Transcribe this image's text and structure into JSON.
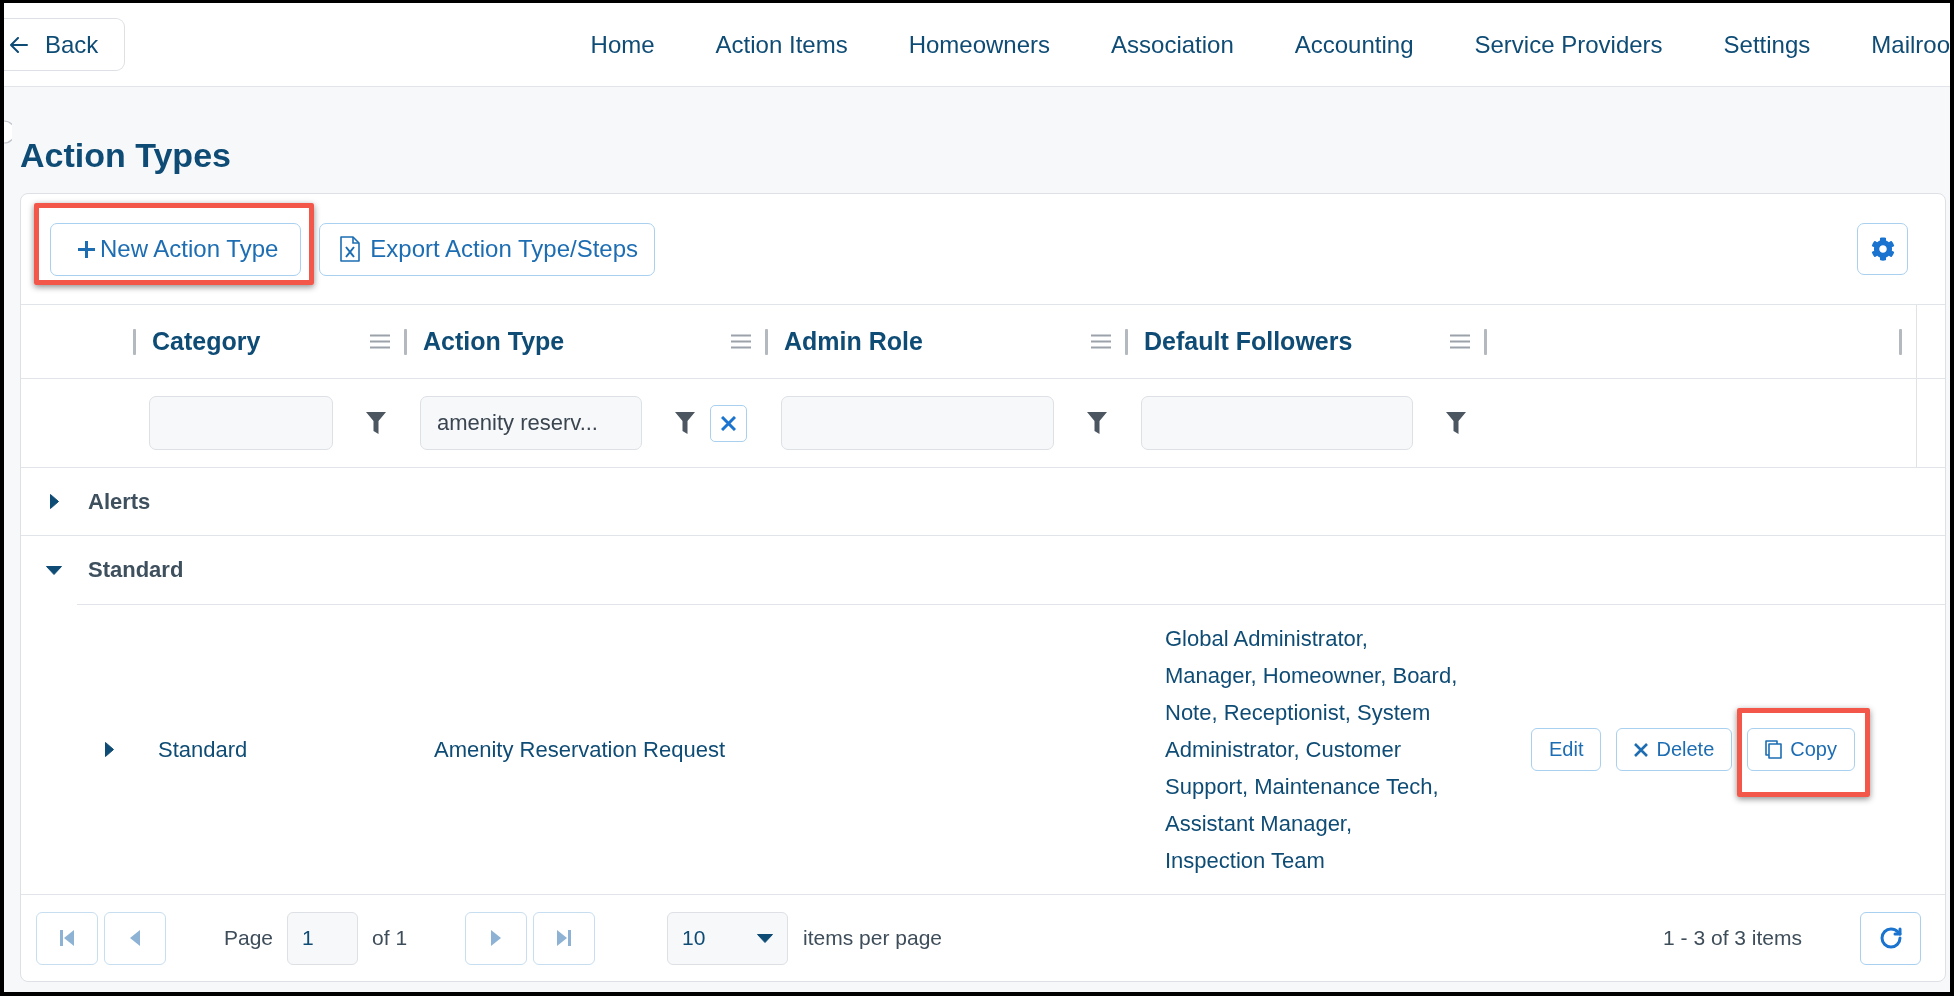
{
  "top_bar": {
    "back": "Back",
    "nav": [
      "Home",
      "Action Items",
      "Homeowners",
      "Association",
      "Accounting",
      "Service Providers",
      "Settings",
      "Mailroo"
    ]
  },
  "page_title": "Action Types",
  "toolbar": {
    "buttons": [
      {
        "kind": "add",
        "label": "New Action Type",
        "highlighted": true
      },
      {
        "kind": "export",
        "label": "Export Action Type/Steps",
        "highlighted": false
      }
    ]
  },
  "table": {
    "columns": [
      {
        "label": "Category"
      },
      {
        "label": "Action Type",
        "filter": "amenity reserv..."
      },
      {
        "label": "Admin Role"
      },
      {
        "label": "Default Followers"
      }
    ],
    "groups": [
      {
        "label": "Alerts",
        "expanded": false
      },
      {
        "label": "Standard",
        "expanded": true,
        "rows": [
          {
            "expanded": false,
            "category": "Standard",
            "action_type": "Amenity Reservation Request",
            "default_followers": "Global Administrator,\nManager, Homeowner, Board,\nNote, Receptionist, System\nAdministrator, Customer\nSupport, Maintenance Tech,\nAssistant Manager,\nInspection Team",
            "actions": [
              {
                "kind": "edit",
                "label": "Edit",
                "highlighted": false
              },
              {
                "kind": "delete",
                "label": "Delete",
                "highlighted": false
              },
              {
                "kind": "copy",
                "label": "Copy",
                "highlighted": true
              }
            ]
          }
        ]
      }
    ]
  },
  "pager": {
    "back_buttons": [
      {
        "kind": "first",
        "disabled": true
      },
      {
        "kind": "previous",
        "disabled": true
      }
    ],
    "page_label": "Page",
    "page": "1",
    "page_count": "of 1",
    "forward_buttons": [
      {
        "kind": "next",
        "disabled": true
      },
      {
        "kind": "last",
        "disabled": true
      }
    ],
    "page_size": "10",
    "page_size_label": "items per page",
    "summary": "1 - 3 of 3 items"
  }
}
